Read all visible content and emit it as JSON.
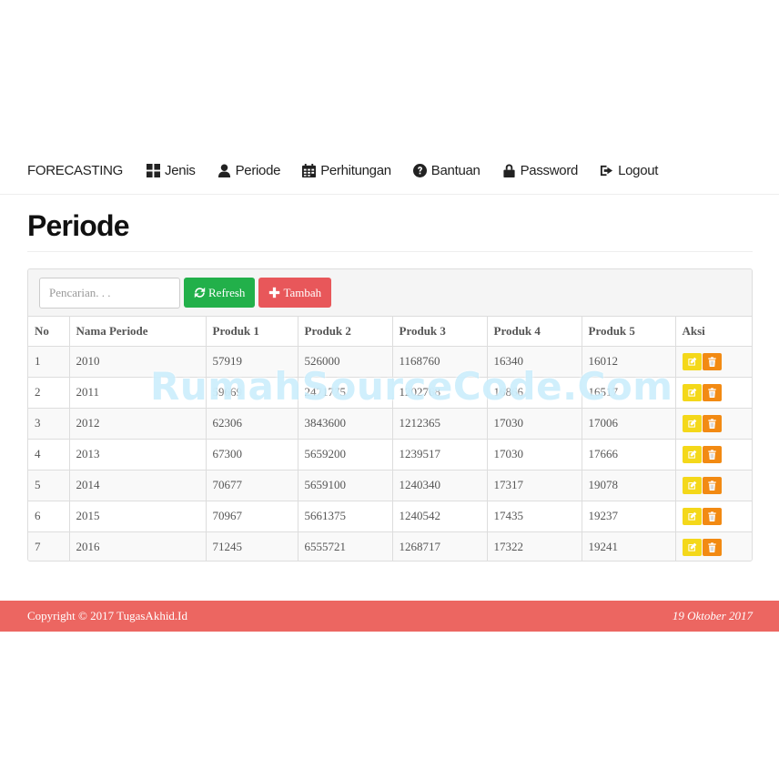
{
  "navbar": {
    "brand": "FORECASTING",
    "items": [
      {
        "label": "Jenis",
        "icon": "grid-icon"
      },
      {
        "label": "Periode",
        "icon": "user-icon"
      },
      {
        "label": "Perhitungan",
        "icon": "calendar-icon"
      },
      {
        "label": "Bantuan",
        "icon": "question-circle-icon"
      },
      {
        "label": "Password",
        "icon": "lock-icon"
      },
      {
        "label": "Logout",
        "icon": "logout-icon"
      }
    ]
  },
  "page": {
    "title": "Periode"
  },
  "toolbar": {
    "search_placeholder": "Pencarian. . .",
    "refresh_label": "Refresh",
    "tambah_label": "Tambah"
  },
  "table": {
    "headers": [
      "No",
      "Nama Periode",
      "Produk 1",
      "Produk 2",
      "Produk 3",
      "Produk 4",
      "Produk 5",
      "Aksi"
    ],
    "rows": [
      [
        "1",
        "2010",
        "57919",
        "526000",
        "1168760",
        "16340",
        "16012"
      ],
      [
        "2",
        "2011",
        "59669",
        "2471775",
        "1202768",
        "16866",
        "16517"
      ],
      [
        "3",
        "2012",
        "62306",
        "3843600",
        "1212365",
        "17030",
        "17006"
      ],
      [
        "4",
        "2013",
        "67300",
        "5659200",
        "1239517",
        "17030",
        "17666"
      ],
      [
        "5",
        "2014",
        "70677",
        "5659100",
        "1240340",
        "17317",
        "19078"
      ],
      [
        "6",
        "2015",
        "70967",
        "5661375",
        "1240542",
        "17435",
        "19237"
      ],
      [
        "7",
        "2016",
        "71245",
        "6555721",
        "1268717",
        "17322",
        "19241"
      ]
    ]
  },
  "watermark": "RumahSourceCode.Com",
  "footer": {
    "copyright": "Copyright © 2017 TugasAkhid.Id",
    "date": "19 Oktober 2017"
  },
  "colors": {
    "refresh": "#22b04a",
    "tambah": "#e8575a",
    "edit": "#f4d81a",
    "delete": "#f28a13",
    "footer": "#ec6661"
  }
}
